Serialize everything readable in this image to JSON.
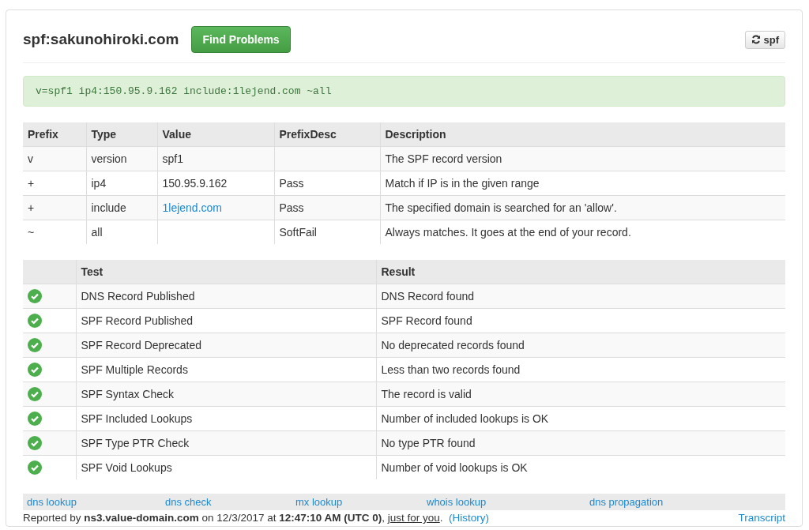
{
  "header": {
    "title": "spf:sakunohiroki.com",
    "action_button": "Find Problems",
    "refresh_button": "spf"
  },
  "record": "v=spf1 ip4:150.95.9.162 include:1lejend.com ~all",
  "mechanisms": {
    "columns": [
      "Prefix",
      "Type",
      "Value",
      "PrefixDesc",
      "Description"
    ],
    "rows": [
      {
        "prefix": "v",
        "type": "version",
        "value": "spf1",
        "value_is_link": false,
        "prefix_desc": "",
        "description": "The SPF record version"
      },
      {
        "prefix": "+",
        "type": "ip4",
        "value": "150.95.9.162",
        "value_is_link": false,
        "prefix_desc": "Pass",
        "description": "Match if IP is in the given range"
      },
      {
        "prefix": "+",
        "type": "include",
        "value": "1lejend.com",
        "value_is_link": true,
        "prefix_desc": "Pass",
        "description": "The specified domain is searched for an 'allow'."
      },
      {
        "prefix": "~",
        "type": "all",
        "value": "",
        "value_is_link": false,
        "prefix_desc": "SoftFail",
        "description": "Always matches. It goes at the end of your record."
      }
    ]
  },
  "tests": {
    "columns": [
      "Test",
      "Result"
    ],
    "rows": [
      {
        "passed": true,
        "test": "DNS Record Published",
        "result": "DNS Record found"
      },
      {
        "passed": true,
        "test": "SPF Record Published",
        "result": "SPF Record found"
      },
      {
        "passed": true,
        "test": "SPF Record Deprecated",
        "result": "No deprecated records found"
      },
      {
        "passed": true,
        "test": "SPF Multiple Records",
        "result": "Less than two records found"
      },
      {
        "passed": true,
        "test": "SPF Syntax Check",
        "result": "The record is valid"
      },
      {
        "passed": true,
        "test": "SPF Included Lookups",
        "result": "Number of included lookups is OK"
      },
      {
        "passed": true,
        "test": "SPF Type PTR Check",
        "result": "No type PTR found"
      },
      {
        "passed": true,
        "test": "SPF Void Lookups",
        "result": "Number of void lookups is OK"
      }
    ]
  },
  "tool_links": [
    "dns lookup",
    "dns check",
    "mx lookup",
    "whois lookup",
    "dns propagation"
  ],
  "report": [
    {
      "kind": "text",
      "text": "Reported by **ns3.value-domain.com** on 12/3/2017 at **12:47:10 AM (UTC 0)**, "
    },
    {
      "kind": "underlined-link",
      "text": "just for you"
    },
    {
      "kind": "text",
      "text": ".  "
    },
    {
      "kind": "link",
      "text": "(History)"
    }
  ],
  "transcript_link": "Transcript"
}
